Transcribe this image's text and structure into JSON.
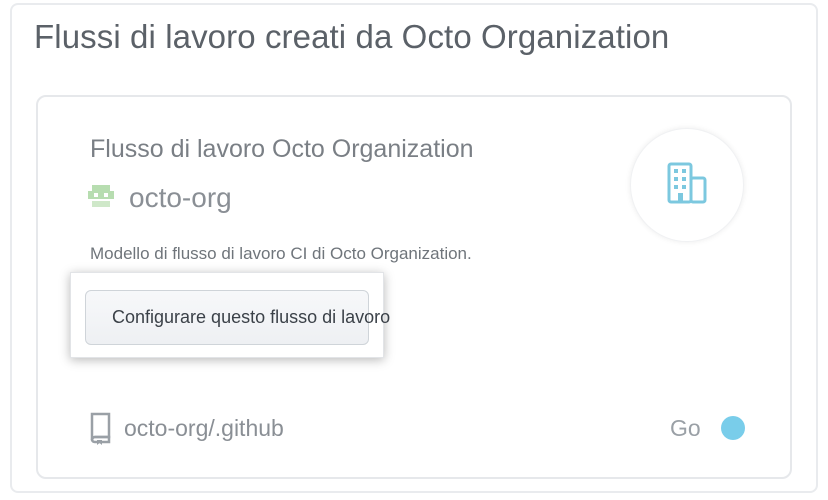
{
  "section": {
    "title": "Flussi di lavoro creati da Octo Organization"
  },
  "card": {
    "title": "Flusso di lavoro Octo Organization",
    "org_name": "octo-org",
    "org_avatar_icon": "octo-org-avatar-icon",
    "badge_icon": "building-icon",
    "description": "Modello di flusso di lavoro CI di Octo Organization.",
    "setup_button_label": "Configurare questo flusso di lavoro",
    "repo_icon": "repo-icon",
    "repo_name": "octo-org/.github",
    "language": {
      "name": "Go",
      "color": "#79cdea"
    }
  },
  "colors": {
    "badge_icon": "#7cc8df",
    "avatar": "#b7ddb0"
  }
}
